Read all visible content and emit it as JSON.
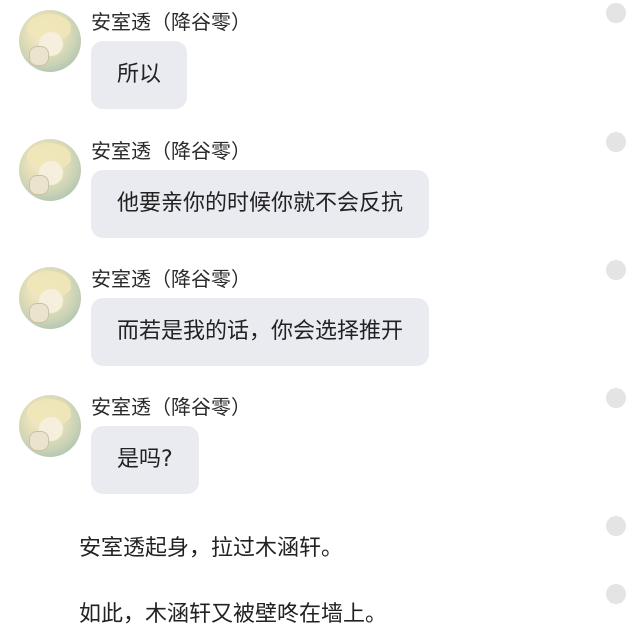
{
  "messages": [
    {
      "sender": "安室透（降谷零）",
      "text": "所以"
    },
    {
      "sender": "安室透（降谷零）",
      "text": "他要亲你的时候你就不会反抗"
    },
    {
      "sender": "安室透（降谷零）",
      "text": "而若是我的话，你会选择推开"
    },
    {
      "sender": "安室透（降谷零）",
      "text": "是吗?"
    }
  ],
  "narrations": [
    {
      "text": "安室透起身，拉过木涵轩。"
    },
    {
      "text": "如此，木涵轩又被壁咚在墙上。"
    }
  ],
  "colors": {
    "bubble": "#e9ebf1",
    "dot": "#e4e4e4",
    "text": "#222222"
  },
  "icons": {
    "avatar": "character-avatar",
    "dot": "circle-action-icon"
  }
}
